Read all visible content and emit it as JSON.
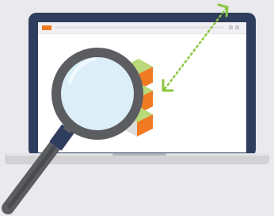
{
  "illustration": {
    "subject": "laptop-with-magnifying-glass",
    "icons": [
      "laptop-icon",
      "browser-window-icon",
      "cube-stack-icon",
      "magnifying-glass-icon",
      "resize-arrow-icon"
    ]
  },
  "colors": {
    "background": "#eae9ee",
    "laptop_bezel": "#2f3d5e",
    "laptop_base": "#d2d2d4",
    "screen": "#ffffff",
    "browser_chrome": "#f1f1f3",
    "browser_accent": "#f07a22",
    "cube_top": "#b9d97a",
    "cube_front_left": "#dcdcdc",
    "cube_front_right": "#f07a22",
    "arrow": "#8cc63f",
    "lens_rim": "#5c5d61",
    "lens_glass": "#dceef8",
    "handle_collar": "#2f3d5e",
    "handle": "#5c5d61"
  }
}
